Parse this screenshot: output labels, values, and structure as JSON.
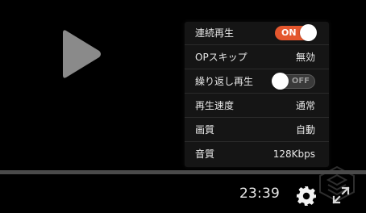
{
  "player": {
    "progress_fraction": 0.0
  },
  "settings": {
    "rows": [
      {
        "label": "連続再生",
        "type": "toggle",
        "state": "on",
        "toggle_text": "ON"
      },
      {
        "label": "OPスキップ",
        "type": "value",
        "value": "無効"
      },
      {
        "label": "繰り返し再生",
        "type": "toggle",
        "state": "off",
        "toggle_text": "OFF"
      },
      {
        "label": "再生速度",
        "type": "value",
        "value": "通常"
      },
      {
        "label": "画質",
        "type": "value",
        "value": "自動"
      },
      {
        "label": "音質",
        "type": "value",
        "value": "128Kbps"
      }
    ]
  },
  "controls": {
    "time": "23:39",
    "settings_icon": "gear-icon",
    "fullscreen_icon": "fullscreen-expand-icon",
    "play_icon": "play-icon"
  },
  "colors": {
    "accent": "#e4572e",
    "background": "#000000",
    "panel": "#151515"
  }
}
